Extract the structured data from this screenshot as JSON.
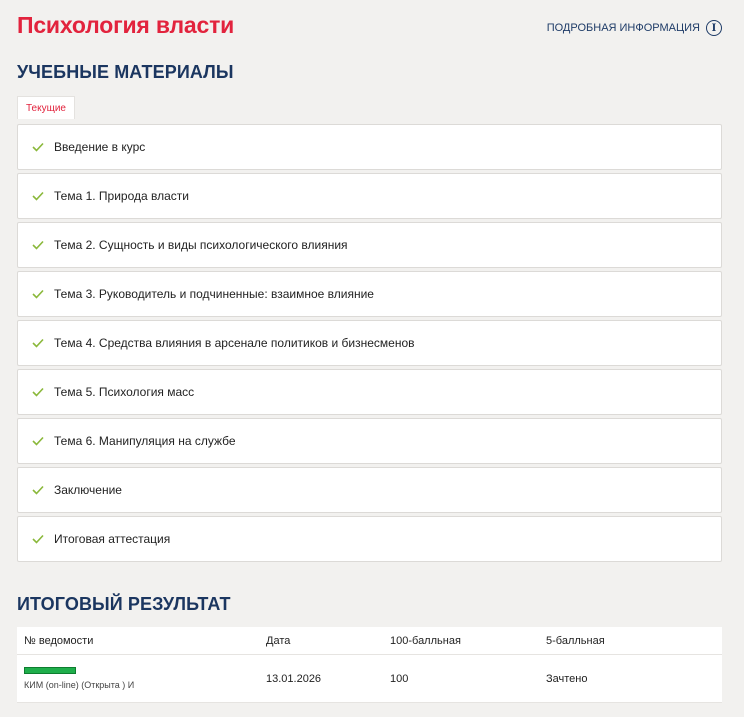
{
  "page": {
    "title": "Психология власти",
    "more_info_label": "ПОДРОБНАЯ ИНФОРМАЦИЯ",
    "info_glyph": "i"
  },
  "materials": {
    "heading": "УЧЕБНЫЕ МАТЕРИАЛЫ",
    "tab_label": "Текущие",
    "items": [
      {
        "label": "Введение в курс"
      },
      {
        "label": "Тема 1. Природа власти"
      },
      {
        "label": "Тема 2. Сущность и виды психологического влияния"
      },
      {
        "label": "Тема 3. Руководитель и подчиненные: взаимное влияние"
      },
      {
        "label": "Тема 4. Средства влияния в арсенале политиков и бизнесменов"
      },
      {
        "label": "Тема 5. Психология масс"
      },
      {
        "label": "Тема 6. Манипуляция на службе"
      },
      {
        "label": "Заключение"
      },
      {
        "label": "Итоговая аттестация"
      }
    ],
    "check_color": "#8ab83a"
  },
  "results": {
    "heading": "ИТОГОВЫЙ РЕЗУЛЬТАТ",
    "columns": [
      "№ ведомости",
      "Дата",
      "100-балльная",
      "5-балльная"
    ],
    "rows": [
      {
        "progress_percent": 100,
        "statement": "КИМ (on-line) (Открыта ) И",
        "date": "13.01.2026",
        "score100": "100",
        "score5": "Зачтено"
      }
    ]
  },
  "colors": {
    "accent_red": "#e2233d",
    "heading_blue": "#1b3660",
    "progress_green": "#1fae4b"
  }
}
